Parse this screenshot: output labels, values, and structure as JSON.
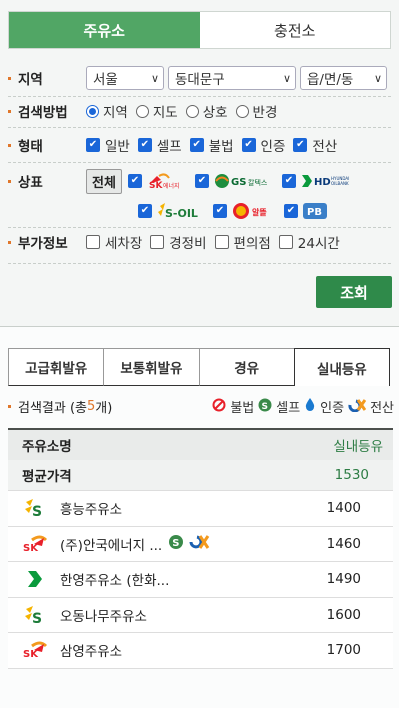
{
  "top_tabs": [
    {
      "label": "주유소",
      "active": true
    },
    {
      "label": "충전소",
      "active": false
    }
  ],
  "filters": {
    "region": {
      "label": "지역",
      "selects": [
        "서울",
        "동대문구",
        "읍/면/동"
      ]
    },
    "method": {
      "label": "검색방법",
      "options": [
        "지역",
        "지도",
        "상호",
        "반경"
      ],
      "selected": "지역"
    },
    "type": {
      "label": "형태",
      "options": [
        "일반",
        "셀프",
        "불법",
        "인증",
        "전산"
      ]
    },
    "brand": {
      "label": "상표",
      "all_button": "전체",
      "brands": [
        "SK에너지",
        "GS칼텍스",
        "HD현대오일뱅크",
        "S-OIL",
        "알뜰",
        "PB"
      ]
    },
    "extra": {
      "label": "부가정보",
      "options": [
        "세차장",
        "경정비",
        "편의점",
        "24시간"
      ]
    }
  },
  "search_button": "조회",
  "fuel_tabs": [
    {
      "label": "고급휘발유"
    },
    {
      "label": "보통휘발유"
    },
    {
      "label": "경유"
    },
    {
      "label": "실내등유",
      "active": true
    }
  ],
  "result": {
    "prefix": "검색결과 (총 ",
    "count": "5",
    "suffix": "개)"
  },
  "legend": {
    "illegal": "불법",
    "self": "셀프",
    "certified": "인증",
    "computer": "전산"
  },
  "table": {
    "col_name": "주유소명",
    "col_price": "실내등유",
    "avg_label": "평균가격",
    "avg_value": "1530",
    "rows": [
      {
        "name": "흥능주유소",
        "price": "1400",
        "brand": "S-OIL"
      },
      {
        "name": "(주)안국에너지 ...",
        "price": "1460",
        "brand": "SK"
      },
      {
        "name": "한영주유소 (한화...",
        "price": "1490",
        "brand": "HD"
      },
      {
        "name": "오동나무주유소",
        "price": "1600",
        "brand": "S-OIL"
      },
      {
        "name": "삼영주유소",
        "price": "1700",
        "brand": "SK"
      }
    ]
  },
  "colors": {
    "accent": "#51a665",
    "button": "#2f8a4a",
    "check": "#1a66d8"
  }
}
